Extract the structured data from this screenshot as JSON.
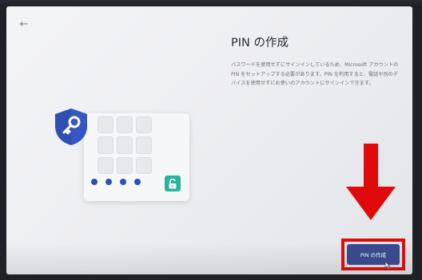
{
  "page": {
    "title": "PIN の作成",
    "description": "パスワードを使用せずにサインインしているため、Microsoft アカウントの PIN をセットアップする必要があります。PIN を利用すると、電話や別のデバイスを使用せずにお使いのアカウントにサインインできます。"
  },
  "nav": {
    "back_icon": "←"
  },
  "actions": {
    "create_pin_label": "PIN の作成"
  },
  "pin_entry": {
    "dot_count": 4
  },
  "colors": {
    "primary_button": "#3a4a8f",
    "highlight": "#e10a0a",
    "shield": "#2f4fb3",
    "lock_accent": "#26b59b"
  }
}
